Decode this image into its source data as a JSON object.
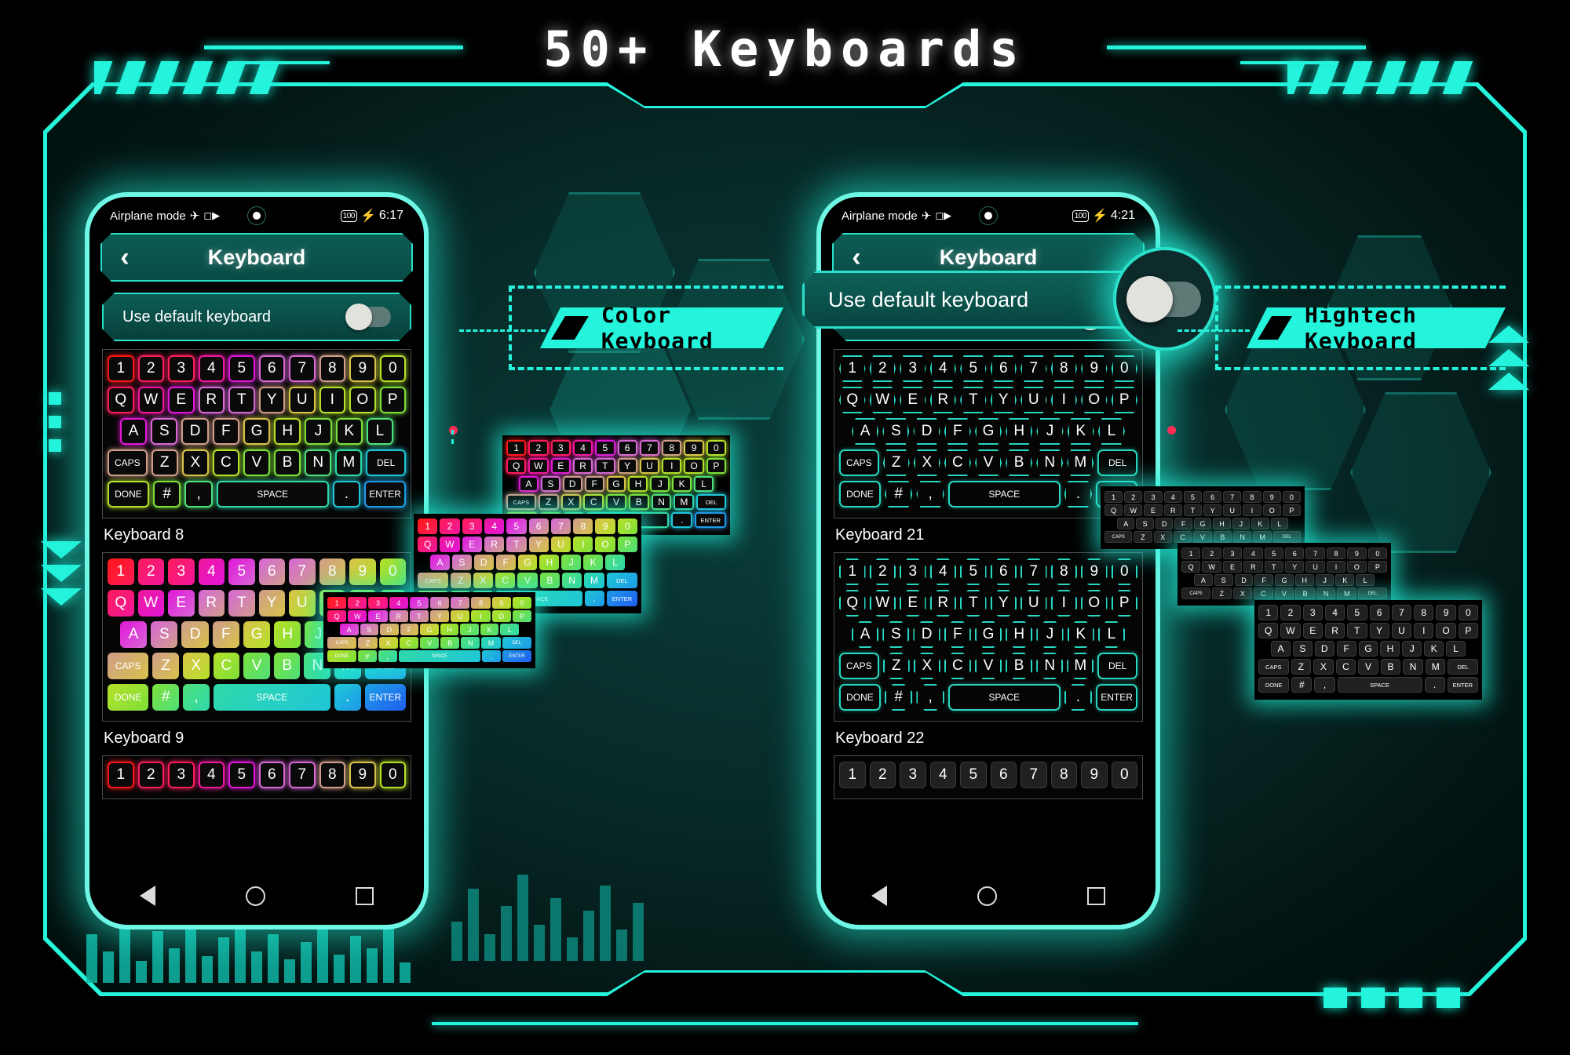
{
  "page": {
    "title": "50+ Keyboards",
    "accent_color": "#25f4dd",
    "background_color": "#000000"
  },
  "callouts": [
    {
      "name": "color-keyboard",
      "label": "Color Keyboard"
    },
    {
      "name": "hightech-keyboard",
      "label": "Hightech Keyboard"
    }
  ],
  "phones": [
    {
      "id": "left",
      "status": {
        "left_text": "Airplane mode",
        "airplane_icon": "airplane-icon",
        "video_icon": "video-camera-icon",
        "battery": "100",
        "charging_icon": "charging-bolt-icon",
        "time": "6:17"
      },
      "header": {
        "back_icon": "back-chevron-icon",
        "title": "Keyboard"
      },
      "default_row": {
        "label": "Use default keyboard",
        "toggle_state": "off"
      },
      "keyboards": [
        {
          "label": "Keyboard 8",
          "style": "kb-outline"
        },
        {
          "label": "Keyboard 9",
          "style": "kb-filled"
        }
      ],
      "nav": {
        "back": "nav-back-icon",
        "home": "nav-home-icon",
        "recents": "nav-recents-icon"
      }
    },
    {
      "id": "right",
      "status": {
        "left_text": "Airplane mode",
        "airplane_icon": "airplane-icon",
        "video_icon": "video-camera-icon",
        "battery": "100",
        "charging_icon": "charging-bolt-icon",
        "time": "4:21"
      },
      "header": {
        "back_icon": "back-chevron-icon",
        "title": "Keyboard"
      },
      "default_row": {
        "label": "Use default keyboard",
        "toggle_state": "off"
      },
      "keyboards": [
        {
          "label": "Keyboard 21",
          "style": "kb-hex"
        },
        {
          "label": "Keyboard 22",
          "style": "kb-oct"
        }
      ],
      "nav": {
        "back": "nav-back-icon",
        "home": "nav-home-icon",
        "recents": "nav-recents-icon"
      }
    }
  ],
  "magnifier": {
    "label": "Use default keyboard",
    "toggle_state": "off"
  },
  "keyboard_layout": {
    "row1": [
      "1",
      "2",
      "3",
      "4",
      "5",
      "6",
      "7",
      "8",
      "9",
      "0"
    ],
    "row2": [
      "Q",
      "W",
      "E",
      "R",
      "T",
      "Y",
      "U",
      "I",
      "O",
      "P"
    ],
    "row3": [
      "A",
      "S",
      "D",
      "F",
      "G",
      "H",
      "J",
      "K",
      "L"
    ],
    "row4": [
      "CAPS",
      "Z",
      "X",
      "C",
      "V",
      "B",
      "N",
      "M",
      "DEL"
    ],
    "row5": [
      "DONE",
      "#",
      ",",
      "SPACE",
      ".",
      "ENTER"
    ]
  },
  "key_colors": {
    "rainbow": [
      "#ff1717",
      "#ff1c5a",
      "#f0179b",
      "#e117d8",
      "#d867d6",
      "#cf9d8a",
      "#d8c34a",
      "#b6e02a",
      "#7ee03a",
      "#4fe07a",
      "#2fd9a8",
      "#1fc6d8",
      "#1f9ae8",
      "#1f5ff0"
    ]
  }
}
